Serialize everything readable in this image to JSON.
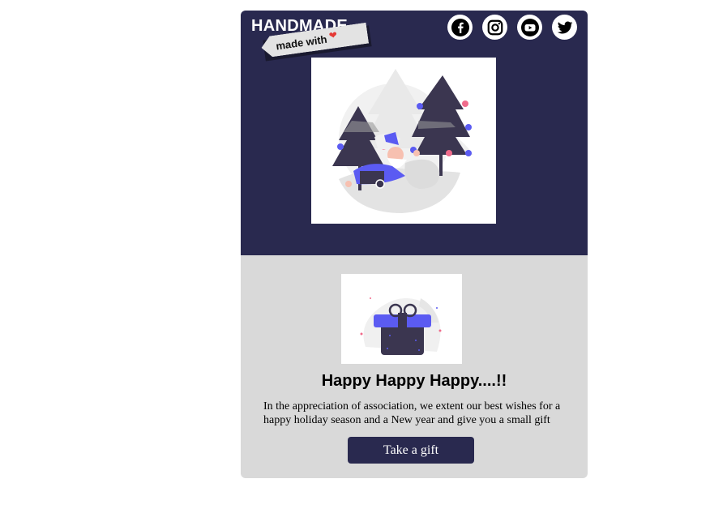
{
  "header": {
    "brand": "HANDMADE",
    "ribbon_label": "made with",
    "ribbon_heart": "❤",
    "socials": [
      {
        "name": "facebook",
        "icon": "facebook-icon"
      },
      {
        "name": "instagram",
        "icon": "instagram-icon"
      },
      {
        "name": "youtube",
        "icon": "youtube-icon"
      },
      {
        "name": "twitter",
        "icon": "twitter-icon"
      }
    ]
  },
  "hero": {
    "illustration": "santa-in-snow-illustration"
  },
  "content": {
    "illustration": "gift-box-illustration",
    "headline": "Happy Happy Happy....!!",
    "message": "In the appreciation of association, we extent our best wishes for a happy holiday season and a New year and give you a small gift",
    "cta_label": "Take a gift"
  },
  "colors": {
    "header_bg": "#29294f",
    "body_bg": "#d9d9d9",
    "accent": "#5b5bf2",
    "pink": "#f06b8b"
  }
}
